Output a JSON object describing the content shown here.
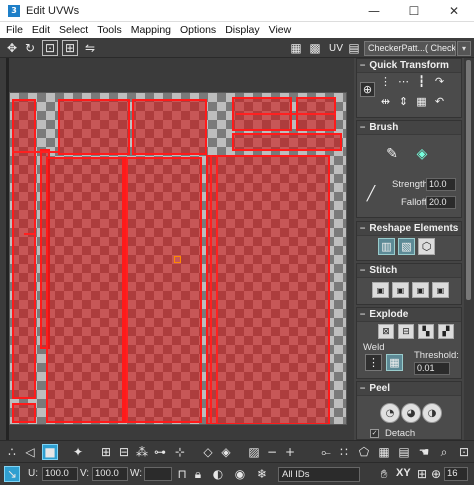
{
  "window": {
    "title": "Edit UVWs",
    "icon_text": "3",
    "minimize_glyph": "—",
    "maximize_glyph": "☐",
    "close_glyph": "✕"
  },
  "menu": [
    "File",
    "Edit",
    "Select",
    "Tools",
    "Mapping",
    "Options",
    "Display",
    "View"
  ],
  "toolbar": {
    "uv_label": "UV",
    "texture_dropdown": "CheckerPatt...( Checker )",
    "dropdown_arrow": "▾",
    "icons": [
      "move-icon",
      "rotate-icon",
      "scale-icon",
      "freeform-icon",
      "mirror-icon",
      "checker-display-icon",
      "show-map-icon"
    ]
  },
  "panel": {
    "quick_transform": {
      "title": "Quick Transform",
      "toggle": "−"
    },
    "brush": {
      "title": "Brush",
      "toggle": "−",
      "strength_label": "Strength:",
      "strength_value": "10.0",
      "falloff_label": "Falloff:",
      "falloff_value": "20.0"
    },
    "reshape": {
      "title": "Reshape Elements",
      "toggle": "−"
    },
    "stitch": {
      "title": "Stitch",
      "toggle": "−"
    },
    "explode": {
      "title": "Explode",
      "toggle": "−",
      "weld_label": "Weld",
      "threshold_label": "Threshold:",
      "threshold_value": "0.01"
    },
    "peel": {
      "title": "Peel",
      "toggle": "−",
      "detach_label": "Detach",
      "detach_checked": "✓"
    }
  },
  "bottom": {
    "u_label": "U:",
    "u_value": "100.0",
    "v_label": "V:",
    "v_value": "100.0",
    "w_label": "W:",
    "w_value": "",
    "ids_dropdown": "All IDs",
    "xy_label": "XY",
    "zoom_value": "16",
    "accent_color": "#2f9fd0"
  }
}
